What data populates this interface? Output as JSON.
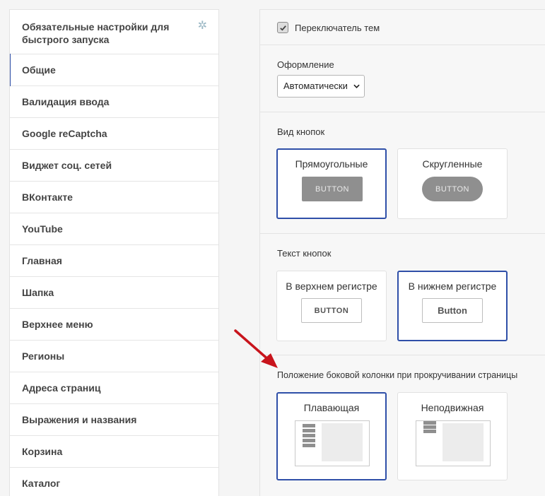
{
  "sidebar": {
    "header": "Обязательные настройки для быстрого запуска",
    "items": [
      {
        "label": "Общие"
      },
      {
        "label": "Валидация ввода"
      },
      {
        "label": "Google reCaptcha"
      },
      {
        "label": "Виджет соц. сетей"
      },
      {
        "label": "ВКонтакте"
      },
      {
        "label": "YouTube"
      },
      {
        "label": "Главная"
      },
      {
        "label": "Шапка"
      },
      {
        "label": "Верхнее меню"
      },
      {
        "label": "Регионы"
      },
      {
        "label": "Адреса страниц"
      },
      {
        "label": "Выражения и названия"
      },
      {
        "label": "Корзина"
      },
      {
        "label": "Каталог"
      }
    ],
    "active_index": 0
  },
  "theme_switch": {
    "label": "Переключатель тем",
    "checked": true
  },
  "design": {
    "label": "Оформление",
    "selected": "Автоматически"
  },
  "button_view": {
    "label": "Вид кнопок",
    "options": [
      {
        "title": "Прямоугольные",
        "sample": "BUTTON",
        "selected": true
      },
      {
        "title": "Скругленные",
        "sample": "BUTTON",
        "selected": false
      }
    ]
  },
  "button_text": {
    "label": "Текст кнопок",
    "options": [
      {
        "title": "В верхнем регистре",
        "sample": "BUTTON",
        "selected": false
      },
      {
        "title": "В нижнем регистре",
        "sample": "Button",
        "selected": true
      }
    ]
  },
  "sidebar_position": {
    "label": "Положение боковой колонки при прокручивании страницы",
    "options": [
      {
        "title": "Плавающая",
        "selected": true
      },
      {
        "title": "Неподвижная",
        "selected": false
      }
    ]
  },
  "colors": {
    "accent": "#2f4fa8",
    "arrow": "#c8141c",
    "sample_button": "#8f8f8f"
  },
  "icons": {
    "sidebar_header": "asterisk-icon",
    "checkbox": "checkmark-icon",
    "select": "chevron-down-icon"
  }
}
